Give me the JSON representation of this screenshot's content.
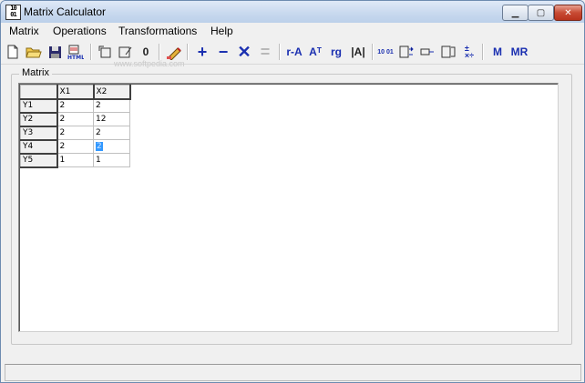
{
  "window": {
    "title": "Matrix Calculator",
    "app_icon_top": "10",
    "app_icon_bottom": "01"
  },
  "menu": [
    "Matrix",
    "Operations",
    "Transformations",
    "Help"
  ],
  "toolbar": {
    "inverse_label": "r-A",
    "transpose_label": "Aᵀ",
    "rank_label": "rg",
    "determinant_label": "|A|",
    "binary_label": "10 01",
    "m_label": "M",
    "mr_label": "MR",
    "zero_label": "0"
  },
  "watermark": "www.softpedia.com",
  "group": {
    "label": "Matrix"
  },
  "grid": {
    "columns": [
      "X1",
      "X2"
    ],
    "rows": [
      {
        "label": "Y1",
        "values": [
          "2",
          "2"
        ]
      },
      {
        "label": "Y2",
        "values": [
          "2",
          "12"
        ]
      },
      {
        "label": "Y3",
        "values": [
          "2",
          "2"
        ]
      },
      {
        "label": "Y4",
        "values": [
          "2",
          "2"
        ]
      },
      {
        "label": "Y5",
        "values": [
          "1",
          "1"
        ]
      }
    ],
    "selected_cell": {
      "row": 3,
      "col": 1
    }
  },
  "status": ""
}
